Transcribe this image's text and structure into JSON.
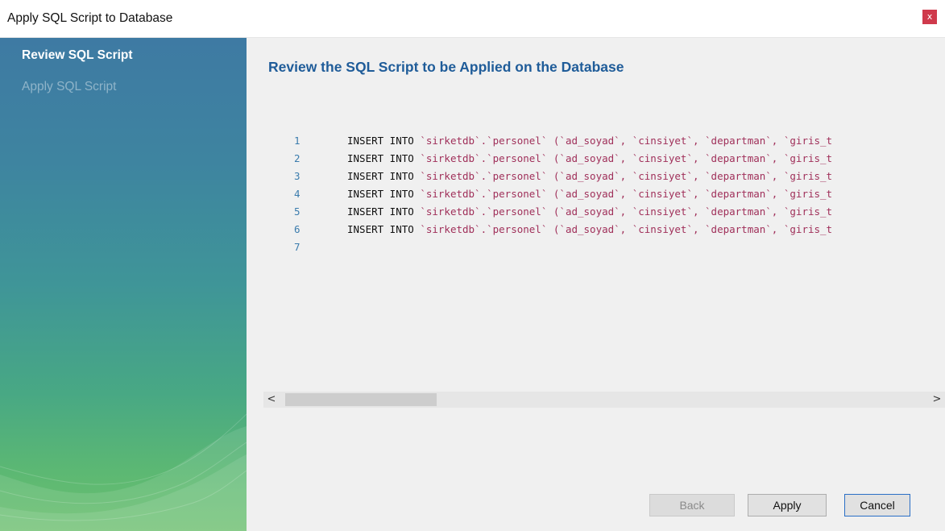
{
  "window": {
    "title": "Apply SQL Script to Database",
    "close_label": "x"
  },
  "sidebar": {
    "steps": [
      {
        "label": "Review SQL Script",
        "active": true
      },
      {
        "label": "Apply SQL Script",
        "active": false
      }
    ]
  },
  "main": {
    "heading": "Review the SQL Script to be Applied on the Database",
    "script_lines": [
      {
        "number": "1",
        "keywords": "INSERT INTO",
        "text": " `sirketdb`.`personel` (`ad_soyad`, `cinsiyet`, `departman`, `giris_t"
      },
      {
        "number": "2",
        "keywords": "INSERT INTO",
        "text": " `sirketdb`.`personel` (`ad_soyad`, `cinsiyet`, `departman`, `giris_t"
      },
      {
        "number": "3",
        "keywords": "INSERT INTO",
        "text": " `sirketdb`.`personel` (`ad_soyad`, `cinsiyet`, `departman`, `giris_t"
      },
      {
        "number": "4",
        "keywords": "INSERT INTO",
        "text": " `sirketdb`.`personel` (`ad_soyad`, `cinsiyet`, `departman`, `giris_t"
      },
      {
        "number": "5",
        "keywords": "INSERT INTO",
        "text": " `sirketdb`.`personel` (`ad_soyad`, `cinsiyet`, `departman`, `giris_t"
      },
      {
        "number": "6",
        "keywords": "INSERT INTO",
        "text": " `sirketdb`.`personel` (`ad_soyad`, `cinsiyet`, `departman`, `giris_t"
      },
      {
        "number": "7",
        "keywords": "",
        "text": ""
      }
    ],
    "scroll_left": "<",
    "scroll_right": ">"
  },
  "buttons": {
    "back": "Back",
    "apply": "Apply",
    "cancel": "Cancel"
  },
  "colors": {
    "heading": "#1f5c99",
    "line_numbers": "#3b7cad",
    "identifiers": "#a0305a",
    "close_button": "#cf3a4c"
  }
}
